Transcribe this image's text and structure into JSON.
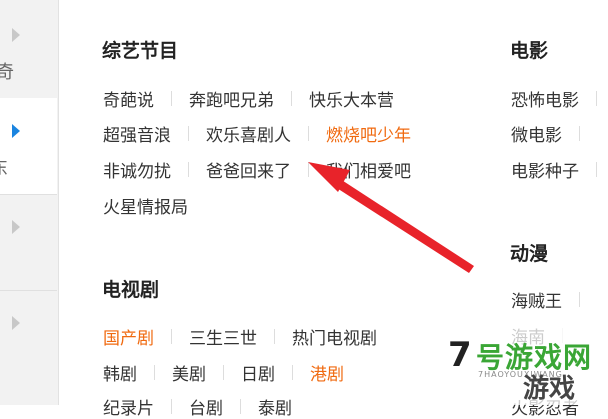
{
  "sidebar": {
    "sections": [
      {
        "label": "奇",
        "state": "inactive"
      },
      {
        "label": "东",
        "state": "active"
      },
      {
        "label": "",
        "state": "inactive"
      },
      {
        "label": "",
        "state": "inactive"
      }
    ]
  },
  "variety": {
    "title": "综艺节目",
    "rows": [
      [
        "奇葩说",
        "奔跑吧兄弟",
        "快乐大本营"
      ],
      [
        "超强音浪",
        "欢乐喜剧人",
        "燃烧吧少年"
      ],
      [
        "非诚勿扰",
        "爸爸回来了",
        "我们相爱吧"
      ],
      [
        "火星情报局"
      ]
    ],
    "highlighted": [
      "燃烧吧少年"
    ]
  },
  "tv": {
    "title": "电视剧",
    "rows": [
      [
        "国产剧",
        "三生三世",
        "热门电视剧"
      ],
      [
        "韩剧",
        "美剧",
        "日剧",
        "港剧"
      ],
      [
        "纪录片",
        "台剧",
        "泰剧"
      ]
    ],
    "highlighted": [
      "国产剧",
      "港剧"
    ]
  },
  "movie": {
    "title": "电影",
    "items": [
      "恐怖电影",
      "微电影",
      "电影种子"
    ]
  },
  "anime": {
    "title": "动漫",
    "items": [
      "海贼王",
      "海南",
      "火影忍者"
    ]
  },
  "watermark": {
    "number": "7",
    "brand": "号游戏网",
    "domain": "7HAOYOUXIWANG",
    "tagline": "游戏"
  },
  "colors": {
    "highlight": "#f06a10",
    "annotation_arrow": "#e8232a",
    "sidebar_active_arrow": "#1a84e0"
  }
}
